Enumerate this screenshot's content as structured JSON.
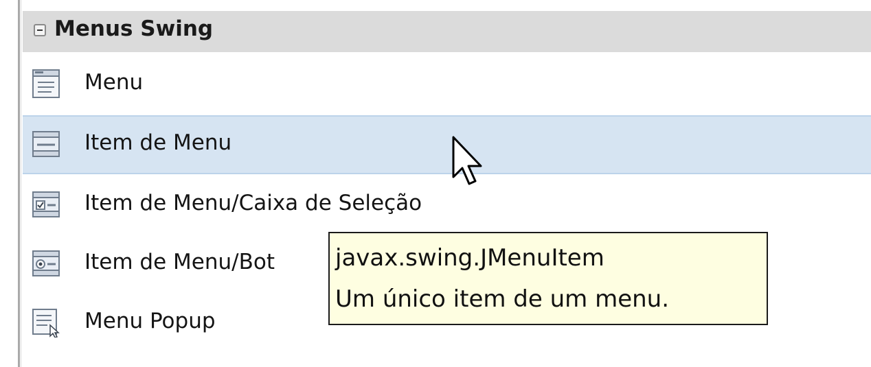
{
  "palette": {
    "category_title": "Menus Swing",
    "items": [
      {
        "label": "Menu",
        "icon": "menu-icon"
      },
      {
        "label": "Item de Menu",
        "icon": "menu-item-icon",
        "selected": true
      },
      {
        "label": "Item de Menu/Caixa de Seleção",
        "icon": "checkbox-menu-item-icon"
      },
      {
        "label": "Item de Menu/Bot",
        "icon": "radio-menu-item-icon"
      },
      {
        "label": "Menu Popup",
        "icon": "popup-menu-icon"
      }
    ]
  },
  "tooltip": {
    "class_name": "javax.swing.JMenuItem",
    "description": "Um único item de um menu."
  },
  "colors": {
    "header_bg": "#dbdbdb",
    "selected_bg": "#d6e4f2",
    "tooltip_bg": "#fefee1"
  }
}
